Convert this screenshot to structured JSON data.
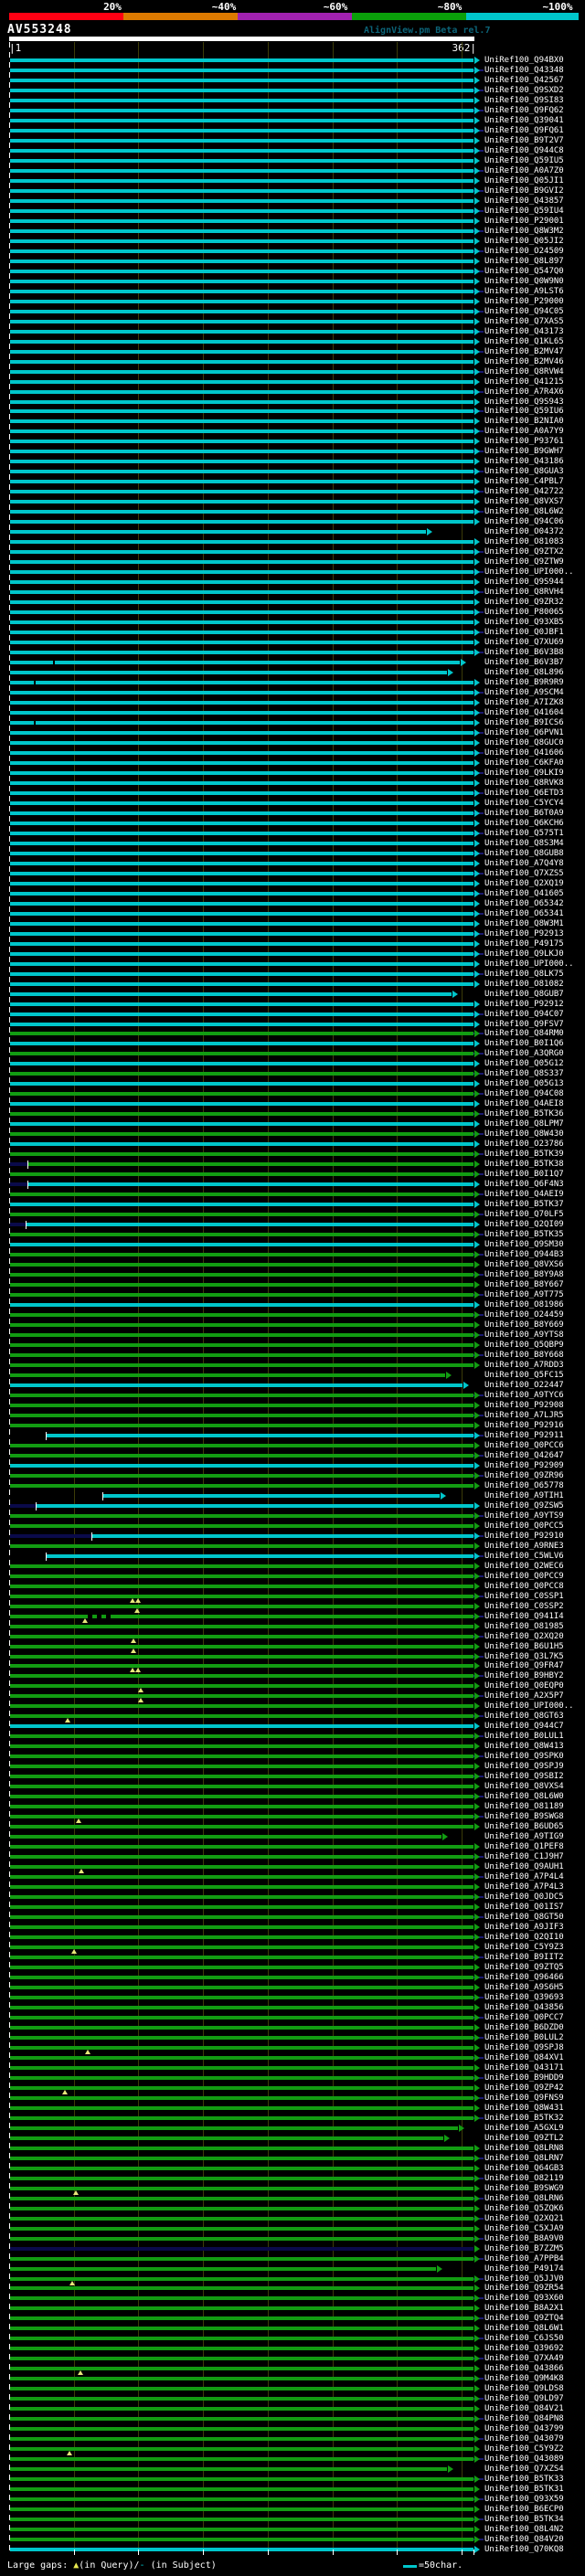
{
  "window": {
    "title": "AV553248",
    "app_title": "AlignView.pm Beta rel.7"
  },
  "score_key": {
    "labels": [
      "20%",
      "~40%",
      "~60%",
      "~80%",
      "~100%"
    ],
    "colors": [
      "#ff0013",
      "#dd7a00",
      "#a121b0",
      "#0aa00a",
      "#00c6cb"
    ]
  },
  "ruler": {
    "start_label": "|1",
    "end_label": "362|"
  },
  "legend": {
    "large_gaps_prefix": "Large gaps: ",
    "query_gap_symbol": "▲",
    "query_gap_text": "(in Query)/",
    "subject_gap_symbol": "-",
    "subject_gap_text": " (in Subject)",
    "scale_symbol_text": "=50char."
  },
  "palette": {
    "cy": "#00c6cb",
    "gr": "#129c12",
    "nv": "#0a0a4a",
    "tail": "#191970",
    "grid": "#3c3c08",
    "gap_triangle": "#e8e87a"
  },
  "chart_data": {
    "type": "bar",
    "orientation": "horizontal",
    "title": "AV553248",
    "x_range": [
      1,
      362
    ],
    "x_units": "query position (characters)",
    "grid_interval_chars": 50,
    "score_buckets": {
      "cy": "~100%",
      "gr": "~80%",
      "nv": "low-score/connector"
    },
    "label_prefix": "UniRef100_",
    "rows": [
      {
        "id": "Q94BX0",
        "c": "cy"
      },
      {
        "id": "Q43348",
        "c": "cy"
      },
      {
        "id": "Q42567",
        "c": "cy"
      },
      {
        "id": "Q9SXD2",
        "c": "cy"
      },
      {
        "id": "Q9SI83",
        "c": "cy"
      },
      {
        "id": "Q9FQ62",
        "c": "cy"
      },
      {
        "id": "Q39041",
        "c": "cy"
      },
      {
        "id": "Q9FQ61",
        "c": "cy"
      },
      {
        "id": "B9T2V7",
        "c": "cy"
      },
      {
        "id": "Q944C8",
        "c": "cy"
      },
      {
        "id": "Q59IU5",
        "c": "cy"
      },
      {
        "id": "A0A7Z0",
        "c": "cy"
      },
      {
        "id": "Q05JI1",
        "c": "cy"
      },
      {
        "id": "B9GVI2",
        "c": "cy"
      },
      {
        "id": "Q43857",
        "c": "cy"
      },
      {
        "id": "Q59IU4",
        "c": "cy"
      },
      {
        "id": "P29001",
        "c": "cy"
      },
      {
        "id": "Q8W3M2",
        "c": "cy"
      },
      {
        "id": "Q05JI2",
        "c": "cy"
      },
      {
        "id": "O24509",
        "c": "cy"
      },
      {
        "id": "Q8L897",
        "c": "cy"
      },
      {
        "id": "Q547Q0",
        "c": "cy"
      },
      {
        "id": "Q0W9N0",
        "c": "cy"
      },
      {
        "id": "A9LST6",
        "c": "cy"
      },
      {
        "id": "P29000",
        "c": "cy"
      },
      {
        "id": "Q94C05",
        "c": "cy"
      },
      {
        "id": "Q7XAS5",
        "c": "cy"
      },
      {
        "id": "Q43173",
        "c": "cy"
      },
      {
        "id": "Q1KL65",
        "c": "cy"
      },
      {
        "id": "B2MV47",
        "c": "cy"
      },
      {
        "id": "B2MV46",
        "c": "cy"
      },
      {
        "id": "Q8RVW4",
        "c": "cy"
      },
      {
        "id": "Q41215",
        "c": "cy"
      },
      {
        "id": "A7R4X6",
        "c": "cy"
      },
      {
        "id": "Q9S943",
        "c": "cy"
      },
      {
        "id": "Q59IU6",
        "c": "cy"
      },
      {
        "id": "B2NIA0",
        "c": "cy"
      },
      {
        "id": "A0A7Y9",
        "c": "cy"
      },
      {
        "id": "P93761",
        "c": "cy"
      },
      {
        "id": "B9GWH7",
        "c": "cy"
      },
      {
        "id": "Q43186",
        "c": "cy"
      },
      {
        "id": "Q8GUA3",
        "c": "cy"
      },
      {
        "id": "C4PBL7",
        "c": "cy"
      },
      {
        "id": "Q42722",
        "c": "cy"
      },
      {
        "id": "Q8VXS7",
        "c": "cy"
      },
      {
        "id": "Q8L6W2",
        "c": "cy"
      },
      {
        "id": "Q94C06",
        "c": "cy"
      },
      {
        "id": "O04372",
        "c": "cy",
        "e": 455
      },
      {
        "id": "O81083",
        "c": "cy"
      },
      {
        "id": "Q9ZTX2",
        "c": "cy"
      },
      {
        "id": "Q9ZTW9",
        "c": "cy"
      },
      {
        "id": "UPI000..",
        "c": "cy"
      },
      {
        "id": "Q9S944",
        "c": "cy"
      },
      {
        "id": "Q8RVH4",
        "c": "cy"
      },
      {
        "id": "Q9ZR32",
        "c": "cy"
      },
      {
        "id": "P80065",
        "c": "cy"
      },
      {
        "id": "Q93XB5",
        "c": "cy"
      },
      {
        "id": "Q0JBF1",
        "c": "cy"
      },
      {
        "id": "Q7XU69",
        "c": "cy"
      },
      {
        "id": "B6V3B8",
        "c": "cy"
      },
      {
        "id": "B6V3B7",
        "c": "cy",
        "e": 492,
        "m": [
          [
            "notch",
            47
          ]
        ]
      },
      {
        "id": "Q8L896",
        "c": "cy",
        "e": 478
      },
      {
        "id": "B9R9R9",
        "c": "cy",
        "m": [
          [
            "notch",
            26
          ]
        ]
      },
      {
        "id": "A9SCM4",
        "c": "cy"
      },
      {
        "id": "A7IZK8",
        "c": "cy"
      },
      {
        "id": "Q41604",
        "c": "cy"
      },
      {
        "id": "B9ICS6",
        "c": "cy",
        "m": [
          [
            "notch",
            26
          ]
        ]
      },
      {
        "id": "Q6PVN1",
        "c": "cy"
      },
      {
        "id": "Q8GUC0",
        "c": "cy"
      },
      {
        "id": "Q41606",
        "c": "cy"
      },
      {
        "id": "C6KFA0",
        "c": "cy"
      },
      {
        "id": "Q9LKI9",
        "c": "cy"
      },
      {
        "id": "Q8RVK8",
        "c": "cy"
      },
      {
        "id": "Q6ETD3",
        "c": "cy"
      },
      {
        "id": "C5YCY4",
        "c": "cy"
      },
      {
        "id": "B6T0A9",
        "c": "cy"
      },
      {
        "id": "Q6KCH6",
        "c": "cy"
      },
      {
        "id": "Q575T1",
        "c": "cy"
      },
      {
        "id": "Q8S3M4",
        "c": "cy"
      },
      {
        "id": "Q8GUB8",
        "c": "cy"
      },
      {
        "id": "A7Q4Y8",
        "c": "cy"
      },
      {
        "id": "Q7XZS5",
        "c": "cy"
      },
      {
        "id": "Q2XQ19",
        "c": "cy"
      },
      {
        "id": "Q41605",
        "c": "cy"
      },
      {
        "id": "O65342",
        "c": "cy"
      },
      {
        "id": "O65341",
        "c": "cy"
      },
      {
        "id": "Q8W3M1",
        "c": "cy"
      },
      {
        "id": "P92913",
        "c": "cy"
      },
      {
        "id": "P49175",
        "c": "cy"
      },
      {
        "id": "Q9LKJ0",
        "c": "cy"
      },
      {
        "id": "UPI000..",
        "c": "cy"
      },
      {
        "id": "Q8LK75",
        "c": "cy"
      },
      {
        "id": "O81082",
        "c": "cy"
      },
      {
        "id": "Q8GUB7",
        "c": "cy",
        "e": 483
      },
      {
        "id": "P92912",
        "c": "cy"
      },
      {
        "id": "Q94C07",
        "c": "cy"
      },
      {
        "id": "Q9FSV7",
        "c": "cy"
      },
      {
        "id": "Q84RM0",
        "c": "gr"
      },
      {
        "id": "B0I1Q6",
        "c": "cy"
      },
      {
        "id": "A3QRG0",
        "c": "gr"
      },
      {
        "id": "Q05G12",
        "c": "cy"
      },
      {
        "id": "Q8S337",
        "c": "gr"
      },
      {
        "id": "Q05G13",
        "c": "cy"
      },
      {
        "id": "Q94C08",
        "c": "gr"
      },
      {
        "id": "Q4AEI8",
        "c": "cy"
      },
      {
        "id": "B5TK36",
        "c": "gr"
      },
      {
        "id": "Q8LPM7",
        "c": "cy"
      },
      {
        "id": "Q8W430",
        "c": "gr"
      },
      {
        "id": "O23786",
        "c": "cy"
      },
      {
        "id": "B5TK39",
        "c": "gr"
      },
      {
        "id": "B5TK38",
        "c": "gr",
        "lead": 20
      },
      {
        "id": "B0I1Q7",
        "c": "gr"
      },
      {
        "id": "Q6F4N3",
        "c": "cy",
        "lead": 20
      },
      {
        "id": "Q4AEI9",
        "c": "gr"
      },
      {
        "id": "B5TK37",
        "c": "cy"
      },
      {
        "id": "Q70LF5",
        "c": "gr"
      },
      {
        "id": "Q2QI09",
        "c": "cy",
        "lead": 18
      },
      {
        "id": "B5TK35",
        "c": "gr"
      },
      {
        "id": "Q9SM30",
        "c": "cy"
      },
      {
        "id": "Q944B3",
        "c": "gr"
      },
      {
        "id": "Q8VXS6",
        "c": "gr"
      },
      {
        "id": "B8Y9A8",
        "c": "gr"
      },
      {
        "id": "B8Y667",
        "c": "gr"
      },
      {
        "id": "A9T775",
        "c": "gr"
      },
      {
        "id": "O81986",
        "c": "cy"
      },
      {
        "id": "O24459",
        "c": "gr"
      },
      {
        "id": "B8Y669",
        "c": "gr"
      },
      {
        "id": "A9YTS8",
        "c": "gr"
      },
      {
        "id": "Q5QBP9",
        "c": "gr"
      },
      {
        "id": "B8Y668",
        "c": "gr"
      },
      {
        "id": "A7RDD3",
        "c": "gr"
      },
      {
        "id": "Q5FC15",
        "c": "gr",
        "e": 476
      },
      {
        "id": "O22447",
        "c": "cy",
        "e": 495
      },
      {
        "id": "A9TYC6",
        "c": "gr"
      },
      {
        "id": "P92908",
        "c": "gr"
      },
      {
        "id": "A7LJR5",
        "c": "gr"
      },
      {
        "id": "P92916",
        "c": "gr"
      },
      {
        "id": "P92911",
        "c": "cy",
        "s": 40
      },
      {
        "id": "Q0PCC6",
        "c": "gr"
      },
      {
        "id": "Q42647",
        "c": "gr"
      },
      {
        "id": "P92909",
        "c": "cy"
      },
      {
        "id": "Q9ZR96",
        "c": "gr"
      },
      {
        "id": "O65778",
        "c": "gr"
      },
      {
        "id": "A9TIH1",
        "c": "cy",
        "s": 102,
        "e": 470
      },
      {
        "id": "Q9ZSW5",
        "c": "cy",
        "lead": 29
      },
      {
        "id": "A9YTS9",
        "c": "gr"
      },
      {
        "id": "Q0PCC5",
        "c": "gr"
      },
      {
        "id": "P92910",
        "c": "cy",
        "lead": 90
      },
      {
        "id": "A9RNE3",
        "c": "gr"
      },
      {
        "id": "C5WLV6",
        "c": "cy",
        "s": 40
      },
      {
        "id": "Q2WEC6",
        "c": "gr"
      },
      {
        "id": "Q0PCC9",
        "c": "gr"
      },
      {
        "id": "Q0PCC8",
        "c": "gr"
      },
      {
        "id": "C0SSP1",
        "c": "gr",
        "m": [
          [
            "tri",
            134
          ],
          [
            "tri",
            140
          ]
        ]
      },
      {
        "id": "C0SSP2",
        "c": "gr",
        "m": [
          [
            "tri",
            139
          ]
        ]
      },
      {
        "id": "Q941I4",
        "c": "gr",
        "m": [
          [
            "dash",
            85,
            115
          ],
          [
            "tri",
            82
          ]
        ]
      },
      {
        "id": "O81985",
        "c": "gr"
      },
      {
        "id": "Q2XQ20",
        "c": "gr",
        "m": [
          [
            "tri",
            135
          ]
        ]
      },
      {
        "id": "B6U1H5",
        "c": "gr",
        "m": [
          [
            "tri",
            135
          ]
        ]
      },
      {
        "id": "Q3L7K5",
        "c": "gr"
      },
      {
        "id": "Q9FR47",
        "c": "gr",
        "m": [
          [
            "tri",
            134
          ],
          [
            "tri",
            140
          ]
        ]
      },
      {
        "id": "B9HBY2",
        "c": "gr"
      },
      {
        "id": "Q0EQP0",
        "c": "gr",
        "m": [
          [
            "tri",
            143
          ]
        ]
      },
      {
        "id": "A2X5P7",
        "c": "gr",
        "m": [
          [
            "tri",
            143
          ]
        ]
      },
      {
        "id": "UPI000..",
        "c": "gr"
      },
      {
        "id": "Q8GT63",
        "c": "gr",
        "m": [
          [
            "tri",
            63
          ]
        ]
      },
      {
        "id": "Q944C7",
        "c": "cy"
      },
      {
        "id": "B0LUL1",
        "c": "gr"
      },
      {
        "id": "Q8W413",
        "c": "gr"
      },
      {
        "id": "Q9SPK0",
        "c": "gr"
      },
      {
        "id": "Q9SPJ9",
        "c": "gr"
      },
      {
        "id": "Q9SBI2",
        "c": "gr"
      },
      {
        "id": "Q8VXS4",
        "c": "gr"
      },
      {
        "id": "Q8L6W0",
        "c": "gr"
      },
      {
        "id": "O81189",
        "c": "gr"
      },
      {
        "id": "B9SWG8",
        "c": "gr",
        "m": [
          [
            "tri",
            75
          ]
        ]
      },
      {
        "id": "B6UD65",
        "c": "gr"
      },
      {
        "id": "A9TIG9",
        "c": "gr",
        "e": 472
      },
      {
        "id": "Q1PEF8",
        "c": "gr"
      },
      {
        "id": "C1J9H7",
        "c": "gr"
      },
      {
        "id": "Q9AUH1",
        "c": "gr",
        "m": [
          [
            "tri",
            78
          ]
        ]
      },
      {
        "id": "A7P4L4",
        "c": "gr"
      },
      {
        "id": "A7P4L3",
        "c": "gr"
      },
      {
        "id": "Q0JDC5",
        "c": "gr"
      },
      {
        "id": "Q01IS7",
        "c": "gr"
      },
      {
        "id": "Q8GT50",
        "c": "gr"
      },
      {
        "id": "A9JIF3",
        "c": "gr"
      },
      {
        "id": "Q2QI10",
        "c": "gr"
      },
      {
        "id": "C5Y9Z3",
        "c": "gr",
        "m": [
          [
            "tri",
            70
          ]
        ]
      },
      {
        "id": "B9IIT2",
        "c": "gr"
      },
      {
        "id": "Q9ZTQ5",
        "c": "gr"
      },
      {
        "id": "Q96466",
        "c": "gr"
      },
      {
        "id": "A9S6H5",
        "c": "gr"
      },
      {
        "id": "Q39693",
        "c": "gr"
      },
      {
        "id": "Q43856",
        "c": "gr"
      },
      {
        "id": "Q0PCC7",
        "c": "gr"
      },
      {
        "id": "B6DZD0",
        "c": "gr"
      },
      {
        "id": "B0LUL2",
        "c": "gr"
      },
      {
        "id": "Q9SPJ8",
        "c": "gr",
        "m": [
          [
            "tri",
            85
          ]
        ]
      },
      {
        "id": "Q84XV1",
        "c": "gr"
      },
      {
        "id": "Q43171",
        "c": "gr"
      },
      {
        "id": "B9HDD9",
        "c": "gr"
      },
      {
        "id": "Q9ZP42",
        "c": "gr",
        "m": [
          [
            "tri",
            60
          ]
        ]
      },
      {
        "id": "Q9FNS9",
        "c": "gr"
      },
      {
        "id": "Q8W431",
        "c": "gr"
      },
      {
        "id": "B5TK32",
        "c": "gr"
      },
      {
        "id": "A5GXL9",
        "c": "gr",
        "e": 490
      },
      {
        "id": "Q9ZTL2",
        "c": "gr",
        "e": 474
      },
      {
        "id": "Q8LRN8",
        "c": "gr"
      },
      {
        "id": "Q8LRN7",
        "c": "gr"
      },
      {
        "id": "Q64GB3",
        "c": "gr"
      },
      {
        "id": "O82119",
        "c": "gr"
      },
      {
        "id": "B9SWG9",
        "c": "gr",
        "m": [
          [
            "tri",
            72
          ]
        ]
      },
      {
        "id": "Q8LRN6",
        "c": "gr"
      },
      {
        "id": "Q5ZQK6",
        "c": "gr"
      },
      {
        "id": "Q2XQ21",
        "c": "gr"
      },
      {
        "id": "C5XJA9",
        "c": "gr"
      },
      {
        "id": "B8A9V0",
        "c": "gr"
      },
      {
        "id": "B7ZZM5",
        "c": "nv"
      },
      {
        "id": "A7PPB4",
        "c": "gr"
      },
      {
        "id": "P49174",
        "c": "gr",
        "e": 466
      },
      {
        "id": "Q5JJV0",
        "c": "gr",
        "m": [
          [
            "tri",
            68
          ]
        ]
      },
      {
        "id": "Q9ZR54",
        "c": "gr"
      },
      {
        "id": "Q93X60",
        "c": "gr"
      },
      {
        "id": "B8A2X1",
        "c": "gr"
      },
      {
        "id": "Q9ZTQ4",
        "c": "gr"
      },
      {
        "id": "Q8L6W1",
        "c": "gr"
      },
      {
        "id": "C6JS50",
        "c": "gr"
      },
      {
        "id": "Q39692",
        "c": "gr"
      },
      {
        "id": "Q7XA49",
        "c": "gr"
      },
      {
        "id": "Q43866",
        "c": "gr",
        "m": [
          [
            "tri",
            77
          ]
        ]
      },
      {
        "id": "Q9M4K8",
        "c": "gr"
      },
      {
        "id": "Q9LDS8",
        "c": "gr"
      },
      {
        "id": "Q9LD97",
        "c": "gr"
      },
      {
        "id": "Q84V21",
        "c": "gr"
      },
      {
        "id": "Q84PN8",
        "c": "gr"
      },
      {
        "id": "Q43799",
        "c": "gr"
      },
      {
        "id": "Q43079",
        "c": "gr"
      },
      {
        "id": "C5Y9Z2",
        "c": "gr",
        "m": [
          [
            "tri",
            65
          ]
        ]
      },
      {
        "id": "Q43089",
        "c": "gr"
      },
      {
        "id": "Q7XZS4",
        "c": "gr",
        "e": 478
      },
      {
        "id": "B5TK33",
        "c": "gr"
      },
      {
        "id": "B5TK31",
        "c": "gr"
      },
      {
        "id": "Q93X59",
        "c": "gr"
      },
      {
        "id": "B6ECP0",
        "c": "gr"
      },
      {
        "id": "B5TK34",
        "c": "gr"
      },
      {
        "id": "Q8L4N2",
        "c": "gr"
      },
      {
        "id": "Q84V20",
        "c": "gr"
      },
      {
        "id": "Q70KQ8",
        "c": "cy"
      }
    ]
  }
}
